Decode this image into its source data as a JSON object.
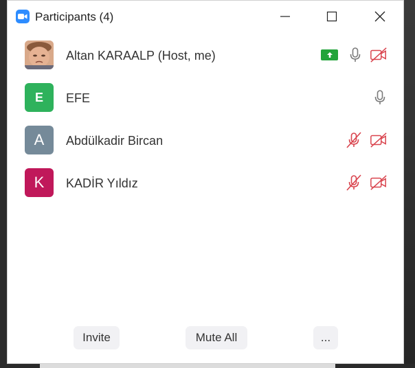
{
  "window": {
    "title": "Participants (4)",
    "controls": [
      "minimize",
      "maximize",
      "close"
    ]
  },
  "participants": [
    {
      "name": "Altan KARAALP (Host, me)",
      "avatar": {
        "type": "photo",
        "letter": "",
        "color": "#c99878"
      },
      "screen_share": true,
      "audio": "on",
      "video": "off"
    },
    {
      "name": "EFE",
      "avatar": {
        "type": "letter",
        "letter": "E",
        "color": "#2eb25c"
      },
      "screen_share": false,
      "audio": "on",
      "video": "none"
    },
    {
      "name": "Abdülkadir Bircan",
      "avatar": {
        "type": "letter",
        "letter": "A",
        "color": "#758a99"
      },
      "screen_share": false,
      "audio": "muted",
      "video": "off"
    },
    {
      "name": "KADİR Yıldız",
      "avatar": {
        "type": "letter",
        "letter": "K",
        "color": "#c0185a"
      },
      "screen_share": false,
      "audio": "muted",
      "video": "off"
    }
  ],
  "footer": {
    "invite_label": "Invite",
    "mute_all_label": "Mute All",
    "more_label": "..."
  },
  "colors": {
    "muted_red": "#d9434d",
    "icon_gray": "#7a7a7a",
    "share_green": "#22a33a",
    "zoom_blue": "#2d8cff"
  }
}
